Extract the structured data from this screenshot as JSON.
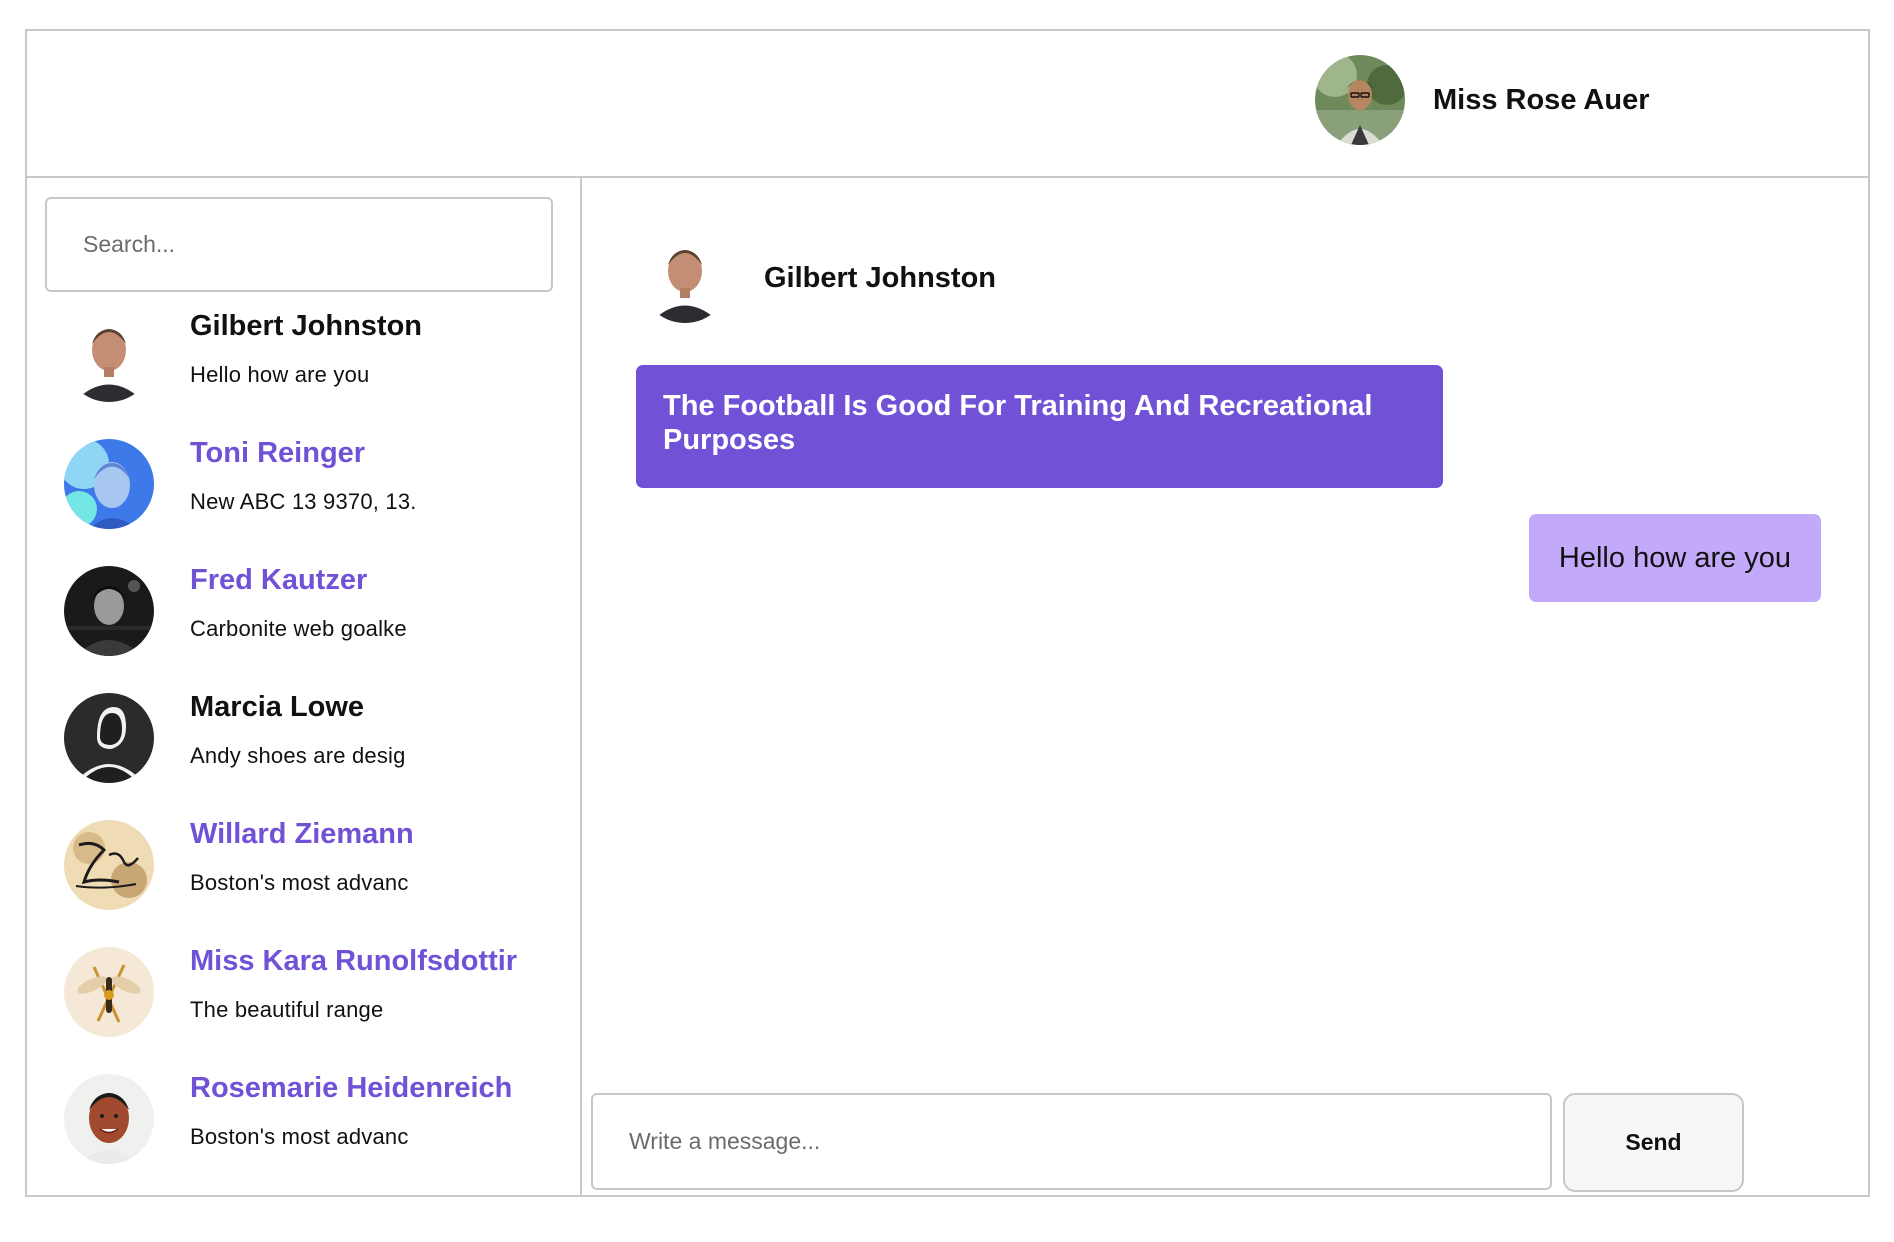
{
  "header": {
    "user_name": "Miss Rose Auer",
    "avatar": "user-avatar-photo"
  },
  "search": {
    "placeholder": "Search..."
  },
  "contacts": [
    {
      "name": "Gilbert Johnston",
      "preview": "Hello how are you",
      "name_color": "#111111",
      "avatar": "man-portrait-photo"
    },
    {
      "name": "Toni Reinger",
      "preview": "New ABC 13 9370, 13.",
      "name_color": "#7151d6",
      "avatar": "blue-lit-face-photo"
    },
    {
      "name": "Fred Kautzer",
      "preview": "Carbonite web goalke",
      "name_color": "#7151d6",
      "avatar": "dark-portrait-photo"
    },
    {
      "name": "Marcia Lowe",
      "preview": "Andy shoes are desig",
      "name_color": "#111111",
      "avatar": "silhouette-avatar"
    },
    {
      "name": "Willard Ziemann",
      "preview": "Boston's most advanc",
      "name_color": "#7151d6",
      "avatar": "signature-art-photo"
    },
    {
      "name": "Miss Kara Runolfsdottir",
      "preview": "The beautiful range",
      "name_color": "#7151d6",
      "avatar": "dragonfly-photo"
    },
    {
      "name": "Rosemarie Heidenreich",
      "preview": "Boston's most advanc",
      "name_color": "#7151d6",
      "avatar": "smiling-man-photo"
    }
  ],
  "chat": {
    "contact_name": "Gilbert Johnston",
    "messages": [
      {
        "direction": "incoming",
        "text": "The Football Is Good For Training And Recreational Purposes"
      },
      {
        "direction": "outgoing",
        "text": "Hello how are you"
      }
    ],
    "composer_placeholder": "Write a message...",
    "send_label": "Send"
  },
  "colors": {
    "accent": "#7151d6",
    "outgoing_bubble": "#c2a9f9",
    "border": "#c9c9c9"
  }
}
